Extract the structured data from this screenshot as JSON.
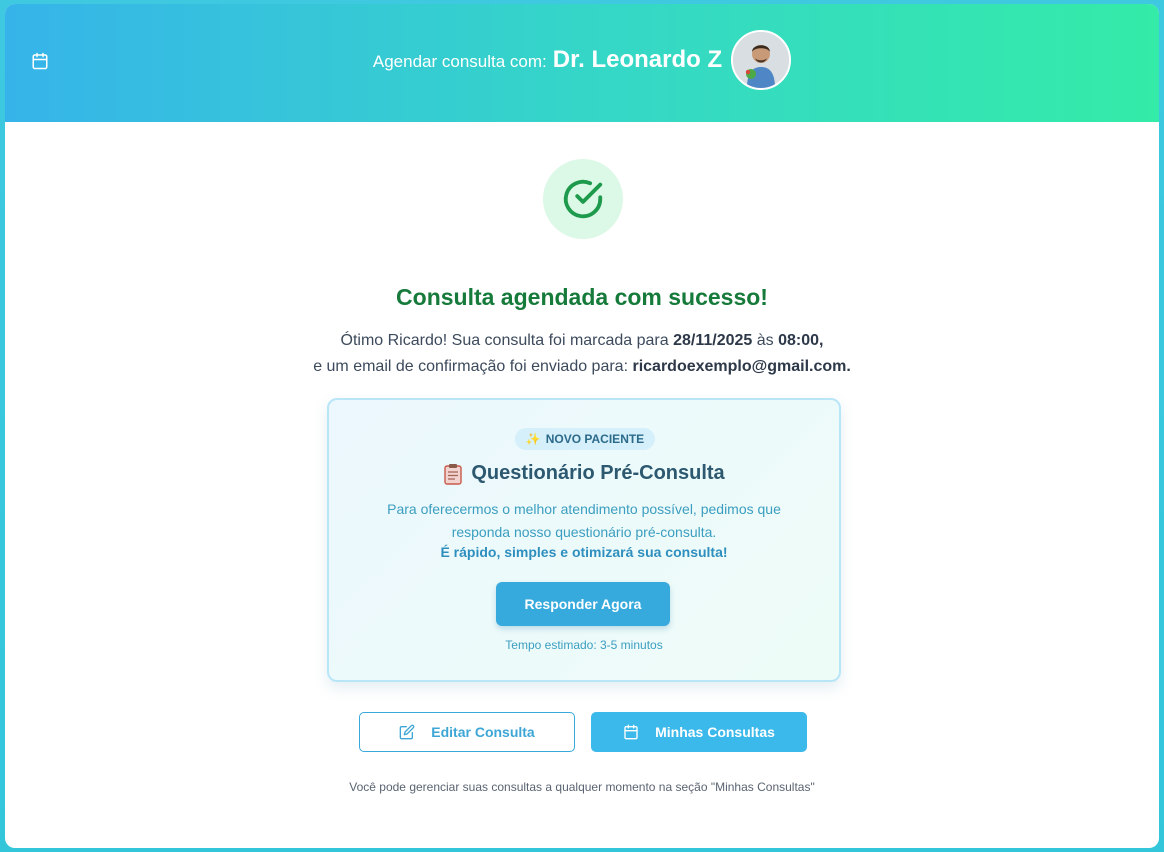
{
  "header": {
    "calendar_icon": "calendar-icon",
    "prefix": "Agendar consulta com:",
    "doctor_name": "Dr. Leonardo Z"
  },
  "success": {
    "icon": "check-circle-icon",
    "title": "Consulta agendada com sucesso!",
    "line1_pre": "Ótimo Ricardo! Sua consulta foi marcada para ",
    "date": "28/11/2025",
    "line1_mid": " às ",
    "time": "08:00,",
    "line2_pre": "e um email de confirmação foi enviado para: ",
    "email": "ricardoexemplo@gmail.com."
  },
  "questionnaire": {
    "badge_icon": "sparkles-icon",
    "badge": "NOVO PACIENTE",
    "title_icon": "clipboard-icon",
    "title": "Questionário Pré-Consulta",
    "desc_line1": "Para oferecermos o melhor atendimento possível, pedimos que",
    "desc_line2": "responda nosso questionário pré-consulta.",
    "emphasis": "É rápido, simples e otimizará sua consulta!",
    "button": "Responder Agora",
    "estimate": "Tempo estimado: 3-5 minutos"
  },
  "actions": {
    "edit_icon": "edit-icon",
    "edit_label": "Editar Consulta",
    "my_icon": "calendar-icon",
    "my_label": "Minhas Consultas"
  },
  "footer": {
    "note": "Você pode gerenciar suas consultas a qualquer momento na seção \"Minhas Consultas\""
  },
  "colors": {
    "header_gradient_start": "#36b4ea",
    "header_gradient_end": "#34eba8",
    "success_green": "#157a3a",
    "primary_blue": "#36a9dd"
  }
}
